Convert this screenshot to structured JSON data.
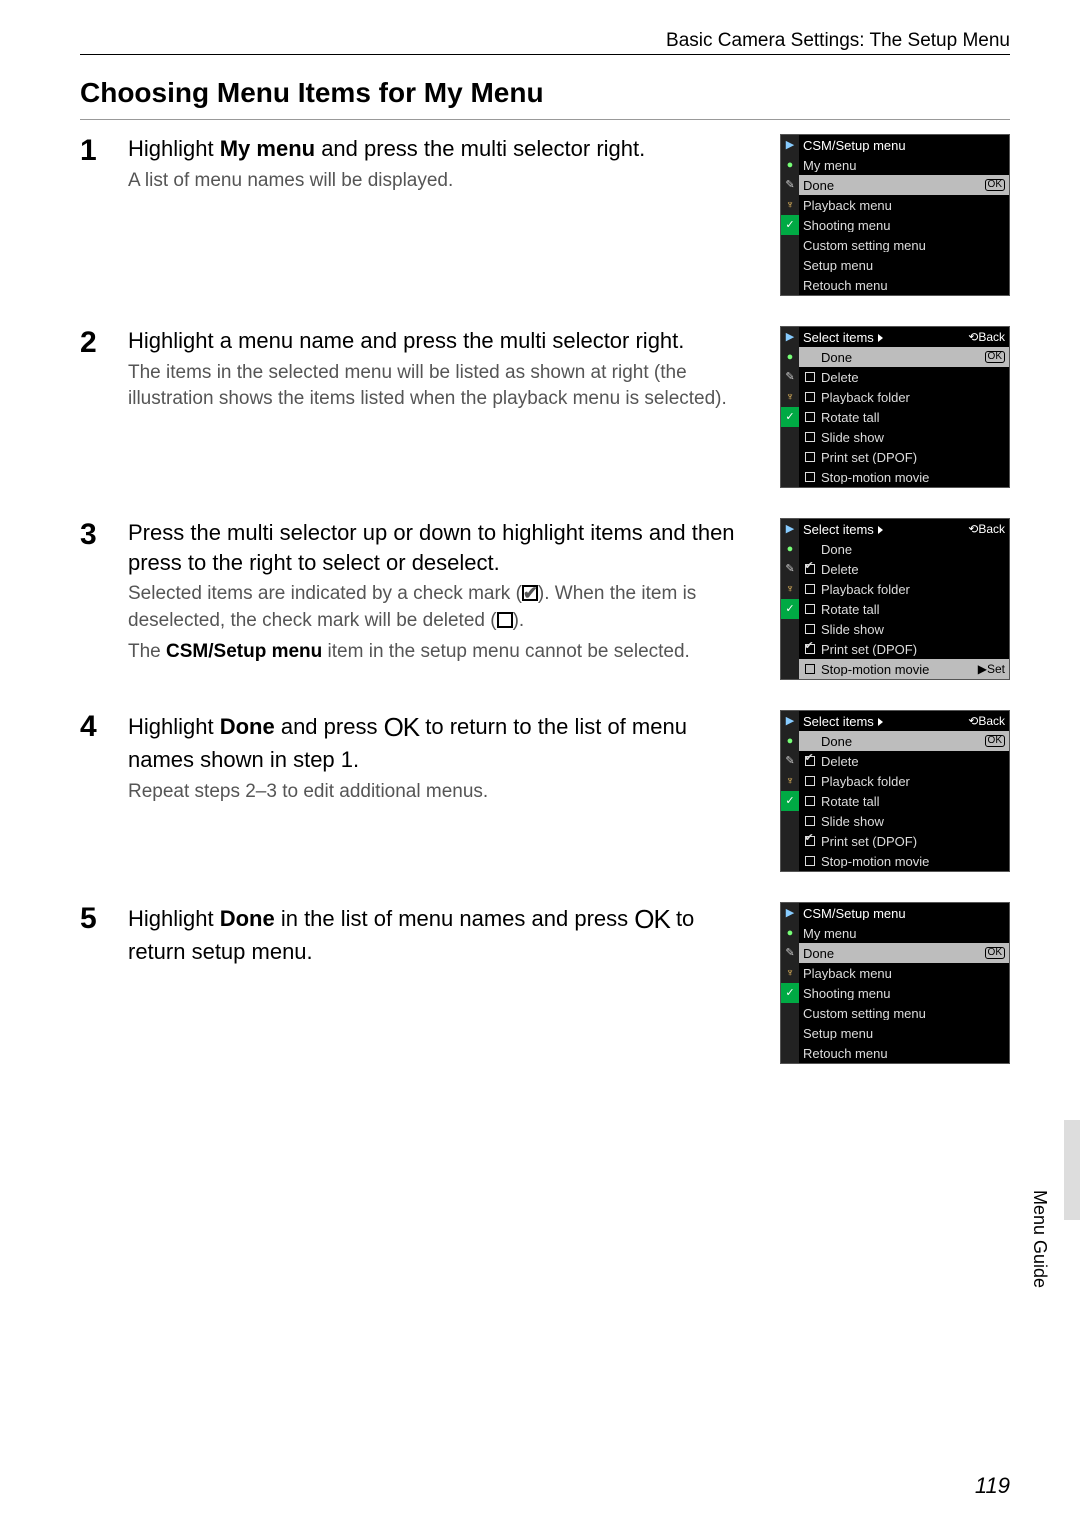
{
  "header": "Basic Camera Settings: The Setup Menu",
  "section_title": "Choosing Menu Items for My Menu",
  "side_label": "Menu Guide",
  "page_number": "119",
  "steps": [
    {
      "num": "1",
      "main_before": "Highlight ",
      "main_bold": "My menu",
      "main_after": " and press the multi selector right.",
      "note": "A list of menu names will be displayed.",
      "lcd": {
        "type": "menus",
        "title": "CSM/Setup menu",
        "highlight_idx": 1,
        "items": [
          "My menu",
          "Done",
          "Playback menu",
          "Shooting menu",
          "Custom setting menu",
          "Setup menu",
          "Retouch menu"
        ],
        "ok_on_highlight": true
      }
    },
    {
      "num": "2",
      "main_plain": "Highlight a menu name and press the multi selector right.",
      "note": "The items in the selected menu will be listed as shown at right (the illustration shows the items listed when the playback menu is selected).",
      "lcd": {
        "type": "select",
        "title": "Select items",
        "highlight_idx": 0,
        "items": [
          {
            "label": "Done",
            "checked": null,
            "ok": true
          },
          {
            "label": "Delete",
            "checked": false
          },
          {
            "label": "Playback folder",
            "checked": false
          },
          {
            "label": "Rotate tall",
            "checked": false
          },
          {
            "label": "Slide show",
            "checked": false
          },
          {
            "label": "Print set (DPOF)",
            "checked": false
          },
          {
            "label": "Stop-motion movie",
            "checked": false
          }
        ]
      }
    },
    {
      "num": "3",
      "main_plain": "Press the multi selector up or down to highlight items and then press to the right to select or deselect.",
      "note_parts": {
        "a": "Selected items are indicated by a check mark (",
        "b": "). When the item is deselected, the check mark will be deleted (",
        "c": ").",
        "d": "The ",
        "e": "CSM/Setup menu",
        "f": " item in the setup menu cannot be selected."
      },
      "lcd": {
        "type": "select",
        "title": "Select items",
        "highlight_idx": 6,
        "set_label": "Set",
        "items": [
          {
            "label": "Done",
            "checked": null
          },
          {
            "label": "Delete",
            "checked": true
          },
          {
            "label": "Playback folder",
            "checked": false
          },
          {
            "label": "Rotate tall",
            "checked": false
          },
          {
            "label": "Slide show",
            "checked": false
          },
          {
            "label": "Print set (DPOF)",
            "checked": true
          },
          {
            "label": "Stop-motion movie",
            "checked": false
          }
        ]
      }
    },
    {
      "num": "4",
      "main_parts": {
        "a": "Highlight ",
        "b": "Done",
        "c": " and press ",
        "d": " to return to the list of menu names shown in step 1."
      },
      "note": "Repeat steps 2–3 to edit additional menus.",
      "lcd": {
        "type": "select",
        "title": "Select items",
        "highlight_idx": 0,
        "items": [
          {
            "label": "Done",
            "checked": null,
            "ok": true
          },
          {
            "label": "Delete",
            "checked": true
          },
          {
            "label": "Playback folder",
            "checked": false
          },
          {
            "label": "Rotate tall",
            "checked": false
          },
          {
            "label": "Slide show",
            "checked": false
          },
          {
            "label": "Print set (DPOF)",
            "checked": true
          },
          {
            "label": "Stop-motion movie",
            "checked": false
          }
        ]
      }
    },
    {
      "num": "5",
      "main_parts": {
        "a": "Highlight ",
        "b": "Done",
        "c": " in the list of menu names and press ",
        "d": " to return setup menu."
      },
      "lcd": {
        "type": "menus",
        "title": "CSM/Setup menu",
        "highlight_idx": 1,
        "items": [
          "My menu",
          "Done",
          "Playback menu",
          "Shooting menu",
          "Custom setting menu",
          "Setup menu",
          "Retouch menu"
        ],
        "ok_on_highlight": true
      }
    }
  ],
  "back_label": "Back"
}
